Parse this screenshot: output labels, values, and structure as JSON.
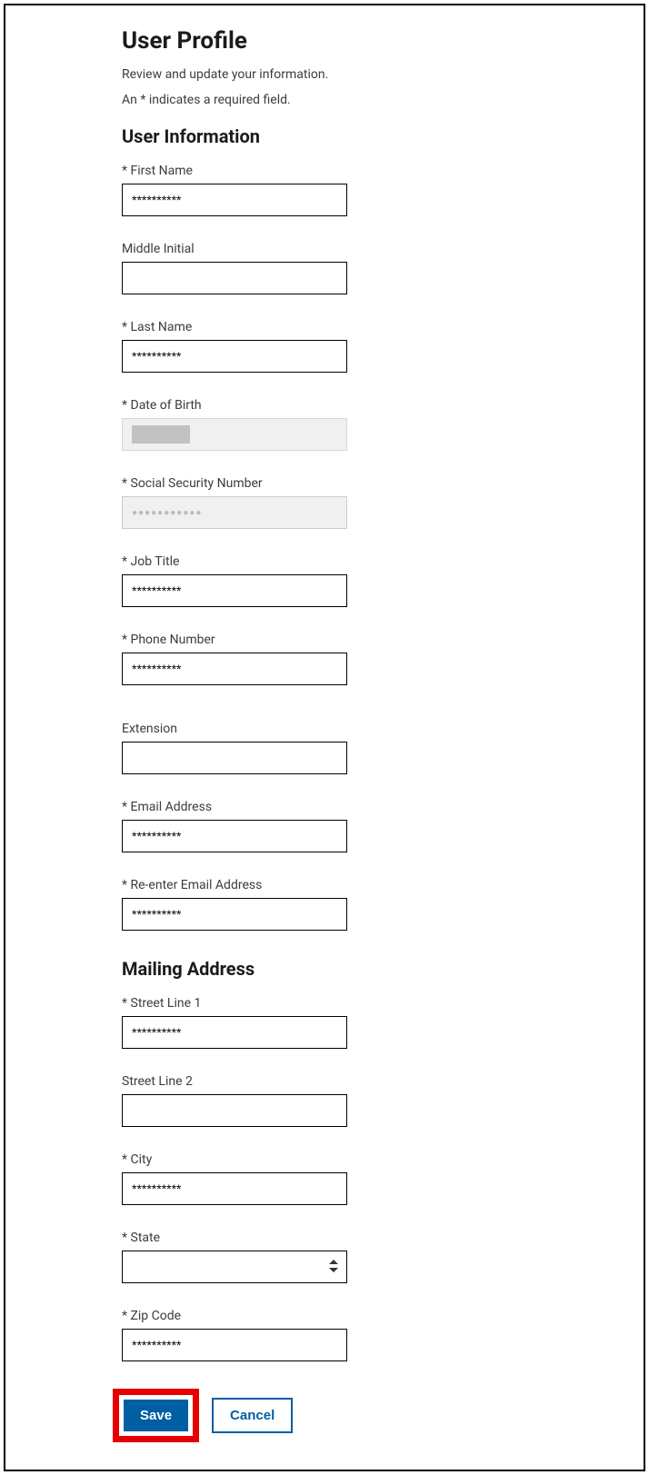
{
  "page": {
    "title": "User Profile",
    "subtitle": "Review and update your information.",
    "required_note": "An * indicates a required field."
  },
  "sections": {
    "user_info": {
      "heading": "User Information",
      "fields": {
        "first_name": {
          "label": "* First Name",
          "value": "**********"
        },
        "middle_initial": {
          "label": "Middle Initial",
          "value": ""
        },
        "last_name": {
          "label": "* Last Name",
          "value": "**********"
        },
        "dob": {
          "label": "* Date of Birth",
          "value": ""
        },
        "ssn": {
          "label": "* Social Security Number",
          "value": ""
        },
        "job_title": {
          "label": "* Job Title",
          "value": "**********"
        },
        "phone": {
          "label": "* Phone Number",
          "value": "**********"
        },
        "extension": {
          "label": "Extension",
          "value": ""
        },
        "email": {
          "label": "* Email Address",
          "value": "**********"
        },
        "email_confirm": {
          "label": "* Re-enter Email Address",
          "value": "**********"
        }
      }
    },
    "mailing": {
      "heading": "Mailing Address",
      "fields": {
        "street1": {
          "label": "* Street Line 1",
          "value": "**********"
        },
        "street2": {
          "label": "Street Line 2",
          "value": ""
        },
        "city": {
          "label": "* City",
          "value": "**********"
        },
        "state": {
          "label": "* State",
          "value": ""
        },
        "zip": {
          "label": "* Zip Code",
          "value": "**********"
        }
      }
    }
  },
  "buttons": {
    "save": "Save",
    "cancel": "Cancel"
  }
}
